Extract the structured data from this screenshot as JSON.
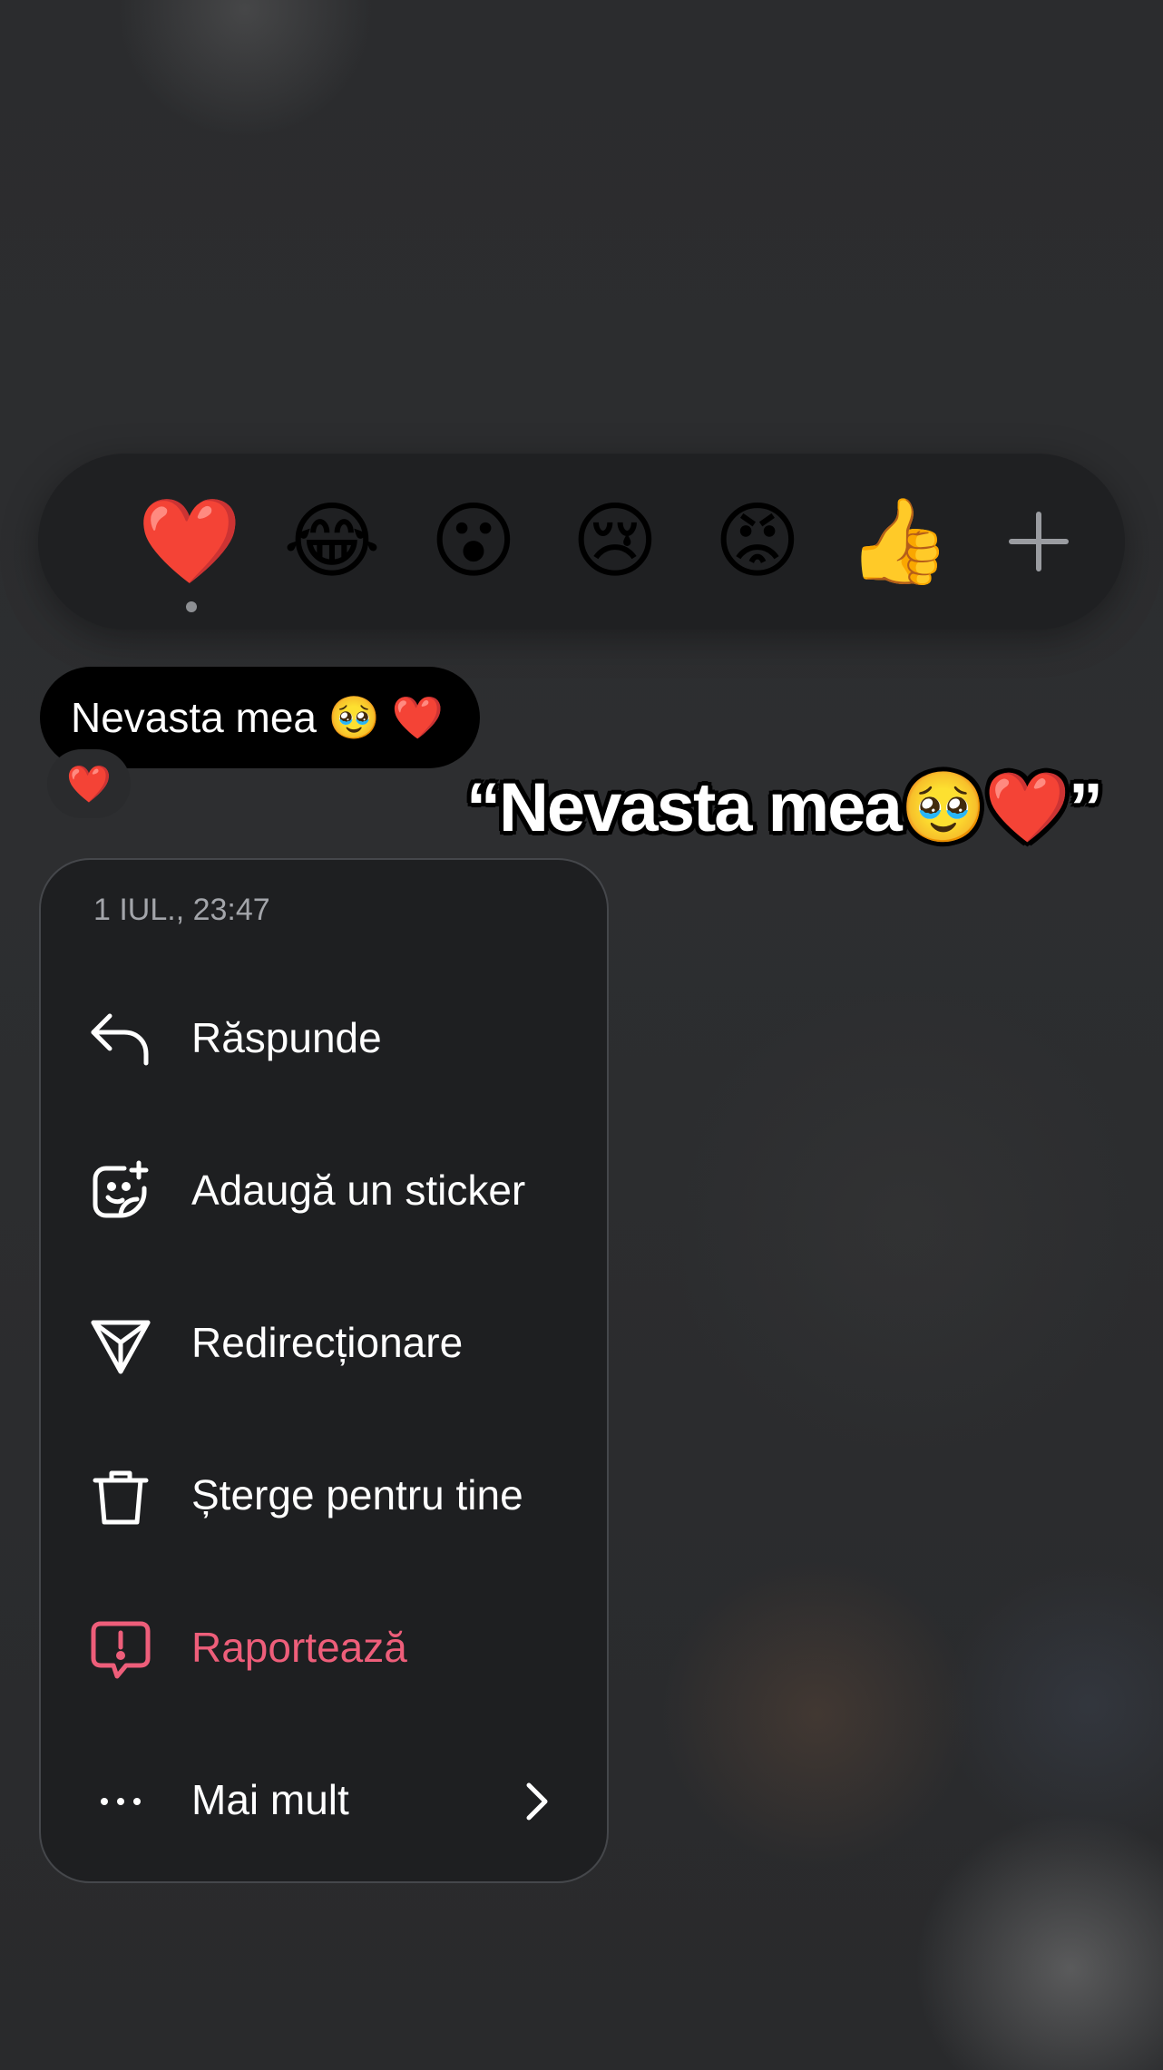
{
  "reactions": {
    "emojis": [
      {
        "glyph": "❤️",
        "name": "heart"
      },
      {
        "glyph": "😂",
        "name": "tears-of-joy"
      },
      {
        "glyph": "😮",
        "name": "surprised"
      },
      {
        "glyph": "😢",
        "name": "crying"
      },
      {
        "glyph": "😡",
        "name": "angry"
      },
      {
        "glyph": "👍",
        "name": "thumbs-up"
      }
    ],
    "selected": "heart",
    "more_icon": "plus-icon"
  },
  "message": {
    "text": "Nevasta mea 🥹 ❤️",
    "reaction": "❤️"
  },
  "caption": "“Nevasta mea🥹❤️”",
  "menu": {
    "timestamp": "1 IUL., 23:47",
    "items": [
      {
        "label": "Răspunde",
        "icon": "reply-icon"
      },
      {
        "label": "Adaugă un sticker",
        "icon": "sticker-add-icon"
      },
      {
        "label": "Redirecționare",
        "icon": "send-icon"
      },
      {
        "label": "Șterge pentru tine",
        "icon": "trash-icon"
      },
      {
        "label": "Raportează",
        "icon": "report-icon"
      },
      {
        "label": "Mai mult",
        "icon": "more-dots-icon"
      }
    ]
  },
  "colors": {
    "danger": "#ee5e7a",
    "menu_bg": "#1e1f21",
    "bubble_bg": "#000000",
    "text": "#ffffff"
  }
}
